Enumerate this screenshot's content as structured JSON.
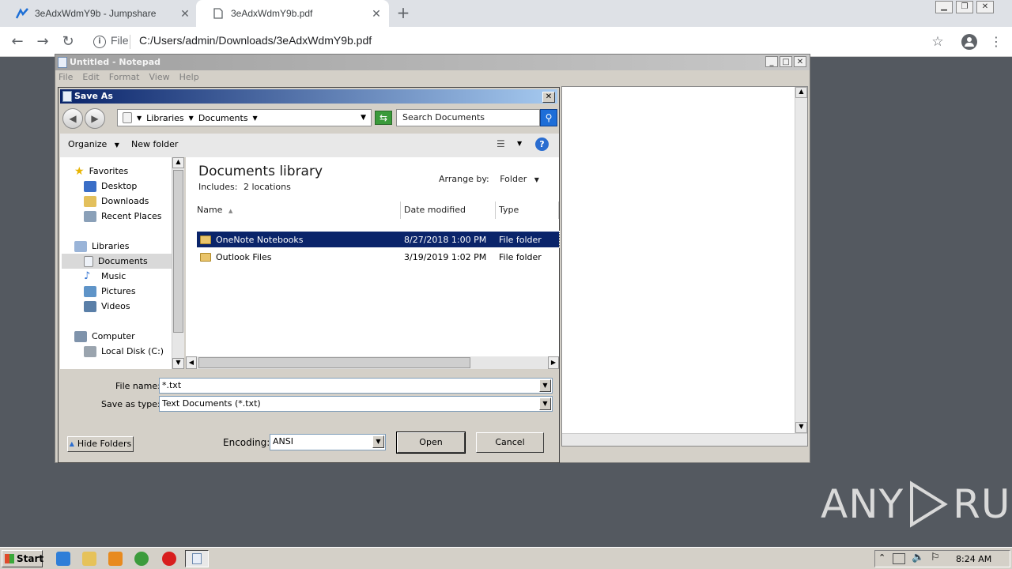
{
  "browser": {
    "tabs": [
      {
        "label": "3eAdxWdmY9b - Jumpshare"
      },
      {
        "label": "3eAdxWdmY9b.pdf"
      }
    ],
    "file_label": "File",
    "url": "C:/Users/admin/Downloads/3eAdxWdmY9b.pdf"
  },
  "notepad": {
    "title": "Untitled - Notepad",
    "menu": [
      "File",
      "Edit",
      "Format",
      "View",
      "Help"
    ]
  },
  "saveas": {
    "title": "Save As",
    "breadcrumb": [
      "Libraries",
      "Documents"
    ],
    "search_placeholder": "Search Documents",
    "toolbar": {
      "organize": "Organize",
      "new_folder": "New folder"
    },
    "nav": {
      "favorites": "Favorites",
      "fav_items": [
        "Desktop",
        "Downloads",
        "Recent Places"
      ],
      "libraries": "Libraries",
      "lib_items": [
        "Documents",
        "Music",
        "Pictures",
        "Videos"
      ],
      "computer": "Computer",
      "comp_items": [
        "Local Disk (C:)"
      ]
    },
    "library": {
      "title": "Documents library",
      "includes": "Includes:",
      "locations": "2 locations",
      "arrange_label": "Arrange by:",
      "arrange_value": "Folder"
    },
    "columns": {
      "name": "Name",
      "date": "Date modified",
      "type": "Type"
    },
    "files": [
      {
        "name": "OneNote Notebooks",
        "date": "8/27/2018 1:00 PM",
        "type": "File folder"
      },
      {
        "name": "Outlook Files",
        "date": "3/19/2019 1:02 PM",
        "type": "File folder"
      }
    ],
    "filename_label": "File name:",
    "filename_value": "*.txt",
    "savetype_label": "Save as type:",
    "savetype_value": "Text Documents (*.txt)",
    "hide_folders": "Hide Folders",
    "encoding_label": "Encoding:",
    "encoding_value": "ANSI",
    "open_btn": "Open",
    "cancel_btn": "Cancel"
  },
  "taskbar": {
    "start": "Start",
    "clock": "8:24 AM"
  },
  "watermark": {
    "left": "ANY",
    "right": "RUN"
  }
}
